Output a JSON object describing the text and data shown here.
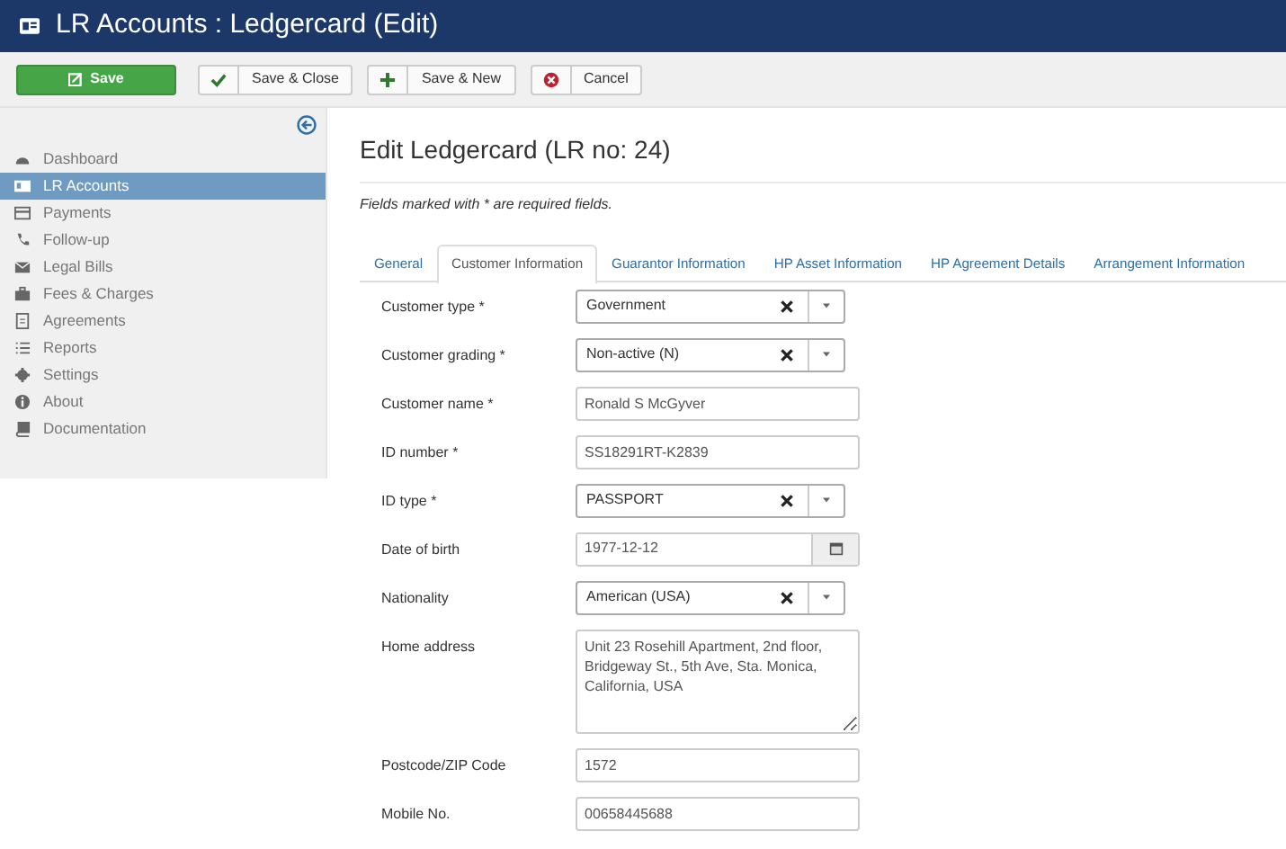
{
  "window": {
    "title": "LR Accounts : Ledgercard (Edit)"
  },
  "toolbar": [
    {
      "label": "Save",
      "kind": "primary"
    },
    {
      "label": "Save & Close",
      "kind": "default"
    },
    {
      "label": "Save & New",
      "kind": "default"
    },
    {
      "label": "Cancel",
      "kind": "default"
    }
  ],
  "sidebar": {
    "items": [
      {
        "label": "Dashboard",
        "selected": false
      },
      {
        "label": "LR Accounts",
        "selected": true
      },
      {
        "label": "Payments",
        "selected": false
      },
      {
        "label": "Follow-up",
        "selected": false
      },
      {
        "label": "Legal Bills",
        "selected": false
      },
      {
        "label": "Fees & Charges",
        "selected": false
      },
      {
        "label": "Agreements",
        "selected": false
      },
      {
        "label": "Reports",
        "selected": false
      },
      {
        "label": "Settings",
        "selected": false
      },
      {
        "label": "About",
        "selected": false
      },
      {
        "label": "Documentation",
        "selected": false
      }
    ]
  },
  "heading": "Edit Ledgercard (LR no: 24)",
  "note": "Fields marked with * are required fields.",
  "tabs": [
    {
      "label": "General",
      "selected": false
    },
    {
      "label": "Customer Information",
      "selected": true
    },
    {
      "label": "Guarantor Information",
      "selected": false
    },
    {
      "label": "HP Asset Information",
      "selected": false
    },
    {
      "label": "HP Agreement Details",
      "selected": false
    },
    {
      "label": "Arrangement Information",
      "selected": false
    }
  ],
  "fields": [
    {
      "label": "Customer type *",
      "kind": "select",
      "value": "Government"
    },
    {
      "label": "Customer grading *",
      "kind": "select",
      "value": "Non-active (N)"
    },
    {
      "label": "Customer name *",
      "kind": "text",
      "value": "Ronald S McGyver"
    },
    {
      "label": "ID number *",
      "kind": "text",
      "value": "SS18291RT-K2839"
    },
    {
      "label": "ID type *",
      "kind": "select",
      "value": "PASSPORT"
    },
    {
      "label": "Date of birth",
      "kind": "date",
      "value": "1977-12-12"
    },
    {
      "label": "Nationality",
      "kind": "select",
      "value": "American (USA)"
    },
    {
      "label": "Home address",
      "kind": "textarea",
      "value": "Unit 23 Rosehill Apartment, 2nd floor, Bridgeway St., 5th Ave, Sta. Monica, California, USA"
    },
    {
      "label": "Postcode/ZIP Code",
      "kind": "text",
      "value": "1572"
    },
    {
      "label": "Mobile No.",
      "kind": "text",
      "value": "00658445688"
    }
  ]
}
